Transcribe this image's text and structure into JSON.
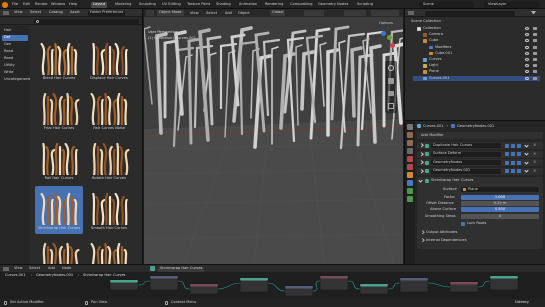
{
  "topbar": {
    "menus": [
      "File",
      "Edit",
      "Render",
      "Window",
      "Help"
    ],
    "workspaces": [
      "Layout",
      "Modeling",
      "Sculpting",
      "UV Editing",
      "Texture Paint",
      "Shading",
      "Animation",
      "Rendering",
      "Compositing",
      "Geometry Nodes",
      "Scripting"
    ],
    "active_workspace": "Layout",
    "scene_label": "Scene",
    "view_layer_label": "ViewLayer"
  },
  "assets": {
    "header": {
      "view": "View",
      "select": "Select",
      "catalog": "Catalog",
      "asset": "Asset",
      "library": "Folder Preferences"
    },
    "search_placeholder": "",
    "categories": [
      "Hair",
      "Def",
      "Gen",
      "Read",
      "Read",
      "Utility",
      "Write",
      "Uncategorized"
    ],
    "selected_category": "Def",
    "items": [
      {
        "label": "Blend Hair Curves"
      },
      {
        "label": "Displace Hair Curves"
      },
      {
        "label": "Frizz Hair Curves"
      },
      {
        "label": "Hair Curves Noise"
      },
      {
        "label": "Roll Hair Curves"
      },
      {
        "label": "Rotate Hair Curves"
      },
      {
        "label": "Shrinkwrap Hair Curves"
      },
      {
        "label": "Smooth Hair Curves"
      },
      {
        "label": "Straighten Hair Curves"
      },
      {
        "label": "Trim Hair Curves"
      }
    ],
    "selected_item": "Shrinkwrap Hair Curves"
  },
  "viewport": {
    "menus": [
      "View",
      "Select",
      "Add",
      "Object"
    ],
    "mode": "Object Mode",
    "orientation": "Global",
    "overlay_text_1": "User Perspective",
    "overlay_text_2": "(1) Collection | Curves.001",
    "options": "Options"
  },
  "outliner": {
    "root": "Scene Collection",
    "rows": [
      {
        "label": "Collection",
        "indent": 0
      },
      {
        "label": "Camera",
        "indent": 1
      },
      {
        "label": "Cube",
        "indent": 1
      },
      {
        "label": "Modifiers",
        "indent": 2
      },
      {
        "label": "Cube.001",
        "indent": 2
      },
      {
        "label": "Curves",
        "indent": 1
      },
      {
        "label": "Light",
        "indent": 1
      },
      {
        "label": "Plane",
        "indent": 1
      },
      {
        "label": "Curves.001",
        "indent": 1
      }
    ],
    "selected": "Curves.001"
  },
  "properties": {
    "breadcrumb_obj": "Curves.001",
    "breadcrumb_mod": "GeometryNodes.001",
    "add_modifier": "Add Modifier",
    "modifiers": [
      "Duplicate Hair Curves",
      "Surface Deform",
      "GeometryNodes",
      "GeometryNodes.001"
    ],
    "shrinkwrap": {
      "title": "Shrinkwrap Hair Curves",
      "surface_label": "Surface",
      "surface_value": "Plane",
      "factor_label": "Factor",
      "factor_value": "1.000",
      "offset_label": "Offset Distance",
      "offset_value": "0.22 m",
      "above_label": "Above Surface",
      "above_value": "0.500",
      "steps_label": "Smoothing Steps",
      "steps_value": "0",
      "lock_label": "Lock Roots"
    },
    "output_attributes": "Output Attributes",
    "internal_deps": "Internal Dependencies"
  },
  "node_editor": {
    "breadcrumb": [
      "Curves.001",
      "GeometryNodes.001",
      "Shrinkwrap Hair Curves"
    ],
    "menus": [
      "View",
      "Select",
      "Add",
      "Node"
    ],
    "group_label": "Shrinkwrap Hair Curves"
  },
  "status": {
    "left": "Set Active Modifier",
    "mid1": "Pan View",
    "mid2": "Context Menu",
    "right": "Udemy"
  }
}
